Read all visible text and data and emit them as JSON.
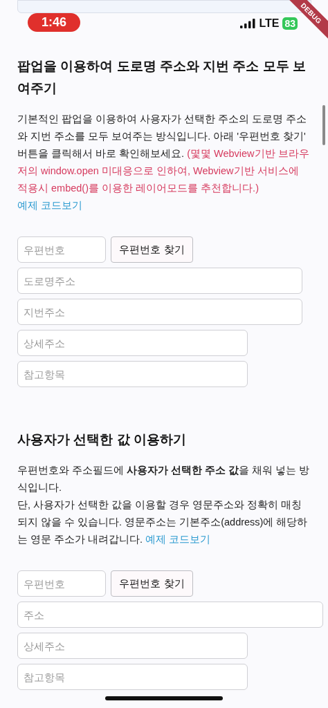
{
  "status_bar": {
    "time": "1:46",
    "network": "LTE",
    "battery": "83"
  },
  "debug_banner": "DEBUG",
  "sections": [
    {
      "title": "팝업을 이용하여 도로명 주소와 지번 주소 모두 보여주기",
      "paragraphs": [
        {
          "kind": "text",
          "text": "기본적인 팝업을 이용하여 사용자가 선택한 주소의 도로명 주소와 지번 주소를 모두 보여주는 방식입니다. 아래 '우편번호 찾기' 버튼을 클릭해서 바로 확인해보세요.",
          "note": "(몇몇 Webview기반 브라우저의 window.open 미대응으로 인하여, Webview기반 서비스에 적용시 embed()를 이용한 레이어모드를 추천합니다.)"
        },
        {
          "kind": "link",
          "text": "예제 코드보기"
        }
      ],
      "rows": [
        {
          "kind": "zip",
          "placeholder": "우편번호",
          "button": "우편번호 찾기"
        },
        {
          "kind": "long",
          "placeholder": "도로명주소"
        },
        {
          "kind": "long",
          "placeholder": "지번주소"
        },
        {
          "kind": "medium",
          "placeholder": "상세주소"
        },
        {
          "kind": "medium",
          "placeholder": "참고항목"
        }
      ]
    },
    {
      "title": "사용자가 선택한 값 이용하기",
      "paragraphs": [
        {
          "kind": "text",
          "text": "우편번호와 주소필드에 **사용자가 선택한 주소 값**을 채워 넣는 방식입니다."
        },
        {
          "kind": "text",
          "text": "단, 사용자가 선택한 값을 이용할 경우 영문주소와 정확히 매칭되지 않을 수 있습니다. 영문주소는 기본주소(address)에 해당하는 영문 주소가 내려갑니다.",
          "link": "예제 코드보기"
        }
      ],
      "rows": [
        {
          "kind": "zip",
          "placeholder": "우편번호",
          "button": "우편번호 찾기"
        },
        {
          "kind": "full",
          "placeholder": "주소"
        },
        {
          "kind": "medium",
          "placeholder": "상세주소"
        },
        {
          "kind": "medium",
          "placeholder": "참고항목"
        }
      ]
    }
  ]
}
